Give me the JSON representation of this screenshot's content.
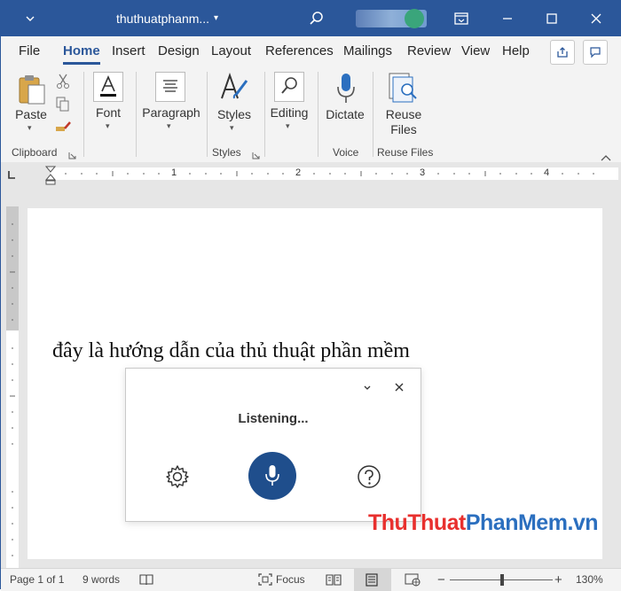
{
  "titlebar": {
    "doc_name": "thuthuatphanm...",
    "caret": "▾",
    "search_icon": "search-icon",
    "ribbon_display_icon": "ribbon-display-icon",
    "minimize": "—",
    "maximize": "☐",
    "close": "✕"
  },
  "tabs": [
    "File",
    "Home",
    "Insert",
    "Design",
    "Layout",
    "References",
    "Mailings",
    "Review",
    "View",
    "Help"
  ],
  "ribbon": {
    "paste": "Paste",
    "font": "Font",
    "paragraph": "Paragraph",
    "styles": "Styles",
    "editing": "Editing",
    "dictate": "Dictate",
    "reuse_line1": "Reuse",
    "reuse_line2": "Files",
    "groups": {
      "clipboard": "Clipboard",
      "styles": "Styles",
      "voice": "Voice",
      "reuse": "Reuse Files"
    }
  },
  "ruler": {
    "numbers": [
      "1",
      "2",
      "3",
      "4"
    ]
  },
  "document": {
    "text": "đây là hướng dẫn của thủ thuật phần mềm"
  },
  "dictation": {
    "status": "Listening..."
  },
  "watermark": {
    "part1": "ThuThuat",
    "part2": "PhanMem.vn"
  },
  "status": {
    "page": "Page 1 of 1",
    "words": "9 words",
    "focus": "Focus",
    "zoom": "130%",
    "zoom_minus": "−",
    "zoom_plus": "+"
  }
}
